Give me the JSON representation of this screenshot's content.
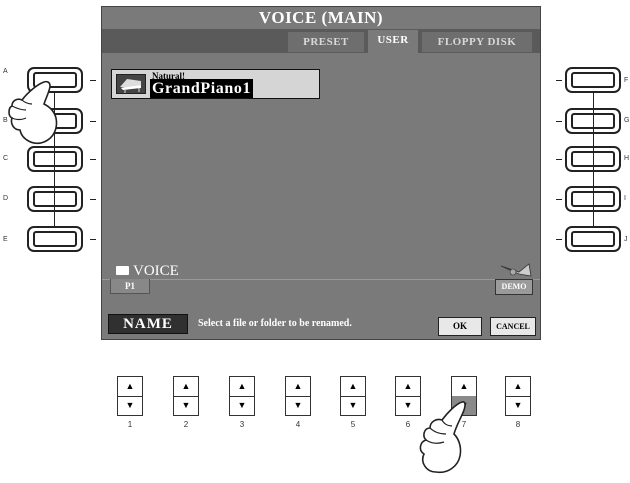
{
  "screen": {
    "title": "VOICE (MAIN)",
    "tabs": [
      {
        "label": "PRESET",
        "active": false
      },
      {
        "label": "USER",
        "active": true
      },
      {
        "label": "FLOPPY DISK",
        "active": false
      }
    ],
    "file": {
      "category": "Natural!",
      "name": "GrandPiano1",
      "icon": "piano-icon"
    },
    "folder_label": "VOICE",
    "page_label": "P1",
    "demo_label": "DEMO",
    "status": {
      "mode_label": "NAME",
      "message": "Select a file or folder to be renamed.",
      "ok_label": "OK",
      "cancel_label": "CANCEL"
    }
  },
  "left_buttons": [
    "A",
    "B",
    "C",
    "D",
    "E"
  ],
  "right_buttons": [
    "F",
    "G",
    "H",
    "I",
    "J"
  ],
  "bottom_buttons": [
    "1",
    "2",
    "3",
    "4",
    "5",
    "6",
    "7",
    "8"
  ],
  "arrows": {
    "up": "▲",
    "down": "▼"
  },
  "hand_icon": "pointing-hand-icon"
}
